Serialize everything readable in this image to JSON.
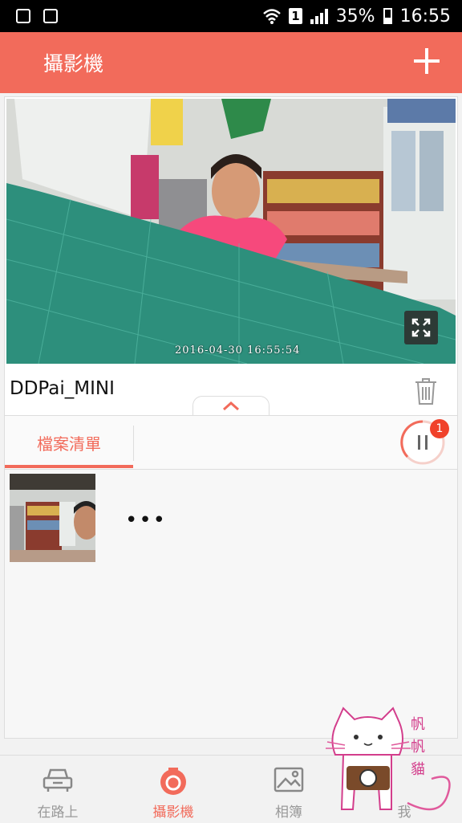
{
  "status_bar": {
    "battery_percent": "35%",
    "time": "16:55",
    "sim_label": "1"
  },
  "app_bar": {
    "title": "攝影機"
  },
  "camera": {
    "timestamp": "2016-04-30 16:55:54",
    "device_name": "DDPai_MINI"
  },
  "tabs": {
    "files_label": "檔案清單",
    "badge_count": "1"
  },
  "file_list": {
    "more_label": "•••"
  },
  "bottom_nav": [
    {
      "label": "在路上"
    },
    {
      "label": "攝影機"
    },
    {
      "label": "相簿"
    },
    {
      "label": "我"
    }
  ],
  "watermark": {
    "text": "帆帆貓"
  },
  "colors": {
    "accent": "#f26b5b",
    "badge": "#f0412a"
  }
}
